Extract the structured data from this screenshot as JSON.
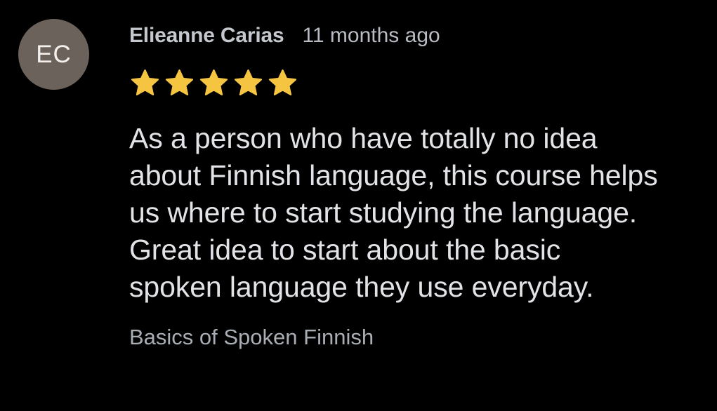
{
  "review": {
    "avatar_initials": "EC",
    "author": "Elieanne Carias",
    "time_ago": "11 months ago",
    "rating": {
      "value": 5,
      "max": 5
    },
    "star_color": "#f5c542",
    "text": "As a person who have totally no idea\nabout Finnish language, this course helps\nus where to start studying the language.\nGreat idea to start about the basic\nspoken language they use everyday.",
    "course_name": "Basics of Spoken Finnish"
  },
  "colors": {
    "background": "#000000",
    "avatar_bg": "#6b625c",
    "author_text": "#c4c7cd",
    "body_text": "#e1e3e6",
    "secondary_text": "#a9adb4"
  }
}
